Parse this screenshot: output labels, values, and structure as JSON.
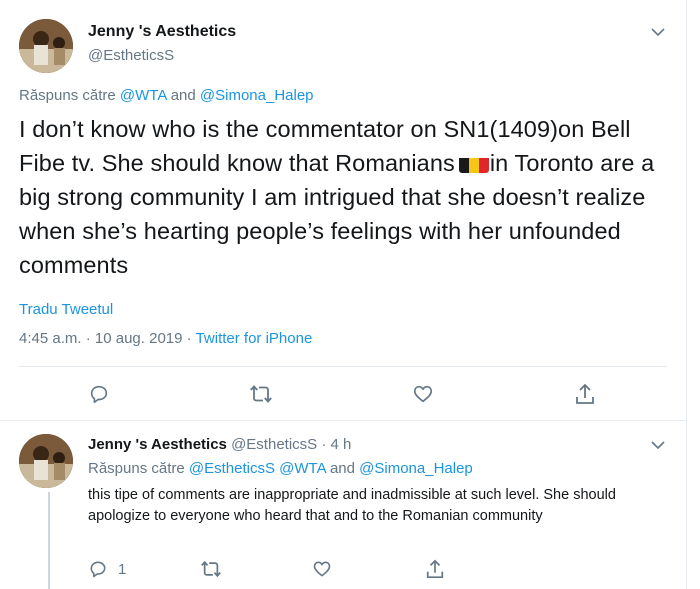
{
  "tweet": {
    "name": "Jenny 's Aesthetics",
    "handle": "@EstheticsS",
    "reply_prefix": "Răspuns către",
    "reply_to_1": "@WTA",
    "reply_and": "and",
    "reply_to_2": "@Simona_Halep",
    "text_part1": "I don’t know who is the commentator on SN1(1409)on Bell Fibe tv. She should know that Romanians",
    "text_part2": "in Toronto are a big strong community   I am intrigued that she doesn’t realize when she’s hearting people’s feelings with her unfounded comments",
    "flag_colors": [
      "#1a1a1a",
      "#f5c518",
      "#e0262b"
    ],
    "translate_label": "Tradu Tweetul",
    "time": "4:45 a.m.",
    "dot": "·",
    "date": "10 aug. 2019",
    "dot2": "·",
    "source": "Twitter for iPhone"
  },
  "reply": {
    "name": "Jenny 's Aesthetics",
    "handle": "@EstheticsS",
    "dot": "·",
    "age": "4 h",
    "reply_prefix": "Răspuns către",
    "reply_to_1": "@EstheticsS",
    "reply_to_2": "@WTA",
    "reply_and": "and",
    "reply_to_3": "@Simona_Halep",
    "text": "this tipe  of comments are inappropriate  and inadmissible at such level. She should apologize to everyone who heard that and to the Romanian community",
    "reply_count": "1"
  },
  "icons": [
    "chevron-down-icon",
    "reply-icon",
    "retweet-icon",
    "like-icon",
    "share-icon"
  ],
  "colors": {
    "link": "#1b95e0",
    "muted": "#657786",
    "text": "#14171a",
    "divider": "#e6ecf0"
  }
}
